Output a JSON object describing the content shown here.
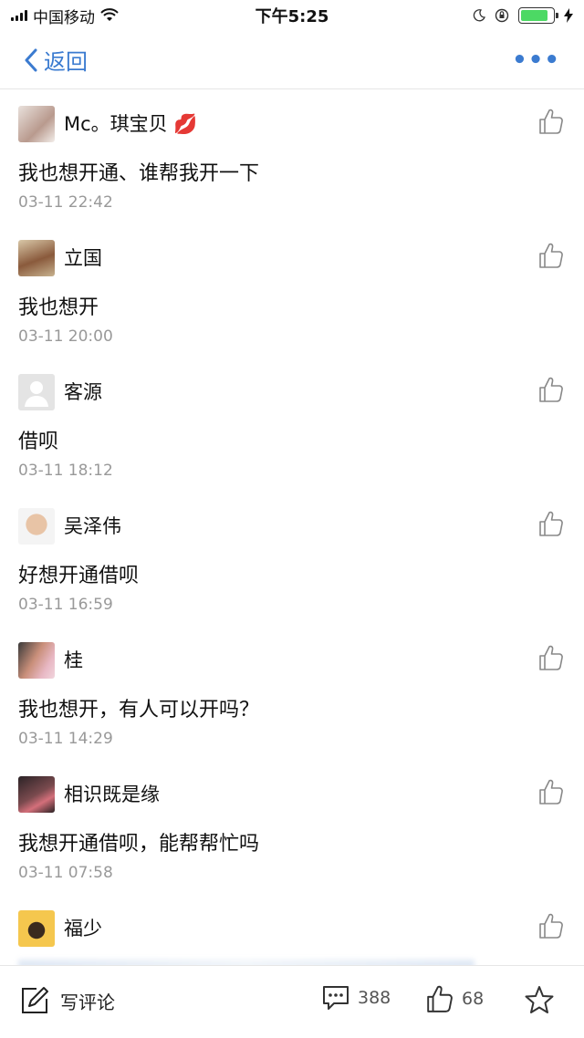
{
  "status_bar": {
    "carrier": "中国移动",
    "time": "下午5:25",
    "battery_level": 0.85
  },
  "nav": {
    "back_label": "返回",
    "more_label": "•••"
  },
  "comments": [
    {
      "name": "Mc。琪宝贝 💋",
      "content": "我也想开通、谁帮我开一下",
      "time": "03-11 22:42"
    },
    {
      "name": "立国",
      "content": "我也想开",
      "time": "03-11 20:00"
    },
    {
      "name": "客源",
      "content": "借呗",
      "time": "03-11 18:12"
    },
    {
      "name": "吴泽伟",
      "content": "好想开通借呗",
      "time": "03-11 16:59"
    },
    {
      "name": "桂",
      "content": "我也想开，有人可以开吗？",
      "time": "03-11 14:29"
    },
    {
      "name": "相识既是缘",
      "content": "我想开通借呗，能帮帮忙吗",
      "time": "03-11 07:58"
    },
    {
      "name": "福少",
      "content": "",
      "time": ""
    }
  ],
  "bottom_bar": {
    "write_label": "写评论",
    "comment_count": "388",
    "like_count": "68"
  },
  "colors": {
    "accent": "#3b7bd0",
    "timestamp": "#999999"
  }
}
